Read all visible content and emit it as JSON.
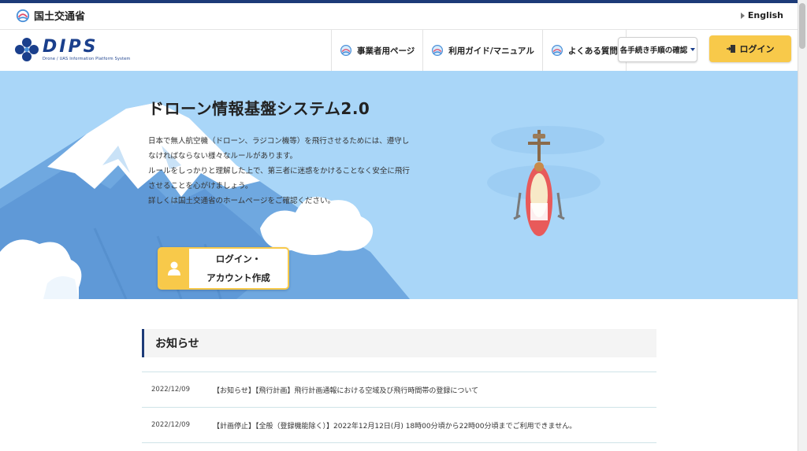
{
  "header": {
    "ministry_name": "国土交通省",
    "english_link": "English"
  },
  "nav": {
    "logo_title": "DIPS",
    "logo_subtitle": "Drone / UAS Information Platform System",
    "links": [
      {
        "label": "事業者用ページ",
        "icon": "mlit-icon"
      },
      {
        "label": "利用ガイド/マニュアル",
        "icon": "mlit-icon"
      },
      {
        "label": "よくある質問",
        "icon": "mlit-icon"
      }
    ],
    "procedure_button": "各手続き手順の確認",
    "login_button": "ログイン"
  },
  "hero": {
    "title": "ドローン情報基盤システム2.0",
    "paragraph_lines": [
      "日本で無人航空機（ドローン、ラジコン機等）を飛行させるためには、遵守し",
      "なければならない様々なルールがあります。",
      "ルールをしっかりと理解した上で、第三者に迷惑をかけることなく安全に飛行",
      "させることを心がけましょう。",
      "詳しくは国土交通省のホームページをご確認ください。"
    ],
    "cta_line1": "ログイン・",
    "cta_line2": "アカウント作成"
  },
  "news": {
    "heading": "お知らせ",
    "items": [
      {
        "date": "2022/12/09",
        "title": "【お知らせ】【飛行計画】飛行計画通報における空域及び飛行時間帯の登録について"
      },
      {
        "date": "2022/12/09",
        "title": "【計画停止】【全般（登録機能除く）】2022年12月12日(月) 18時00分頃から22時00分頃までご利用できません。"
      }
    ]
  },
  "colors": {
    "brand_navy": "#1d3b78",
    "accent_yellow": "#f8c94a",
    "hero_sky": "#a9d6f8"
  }
}
